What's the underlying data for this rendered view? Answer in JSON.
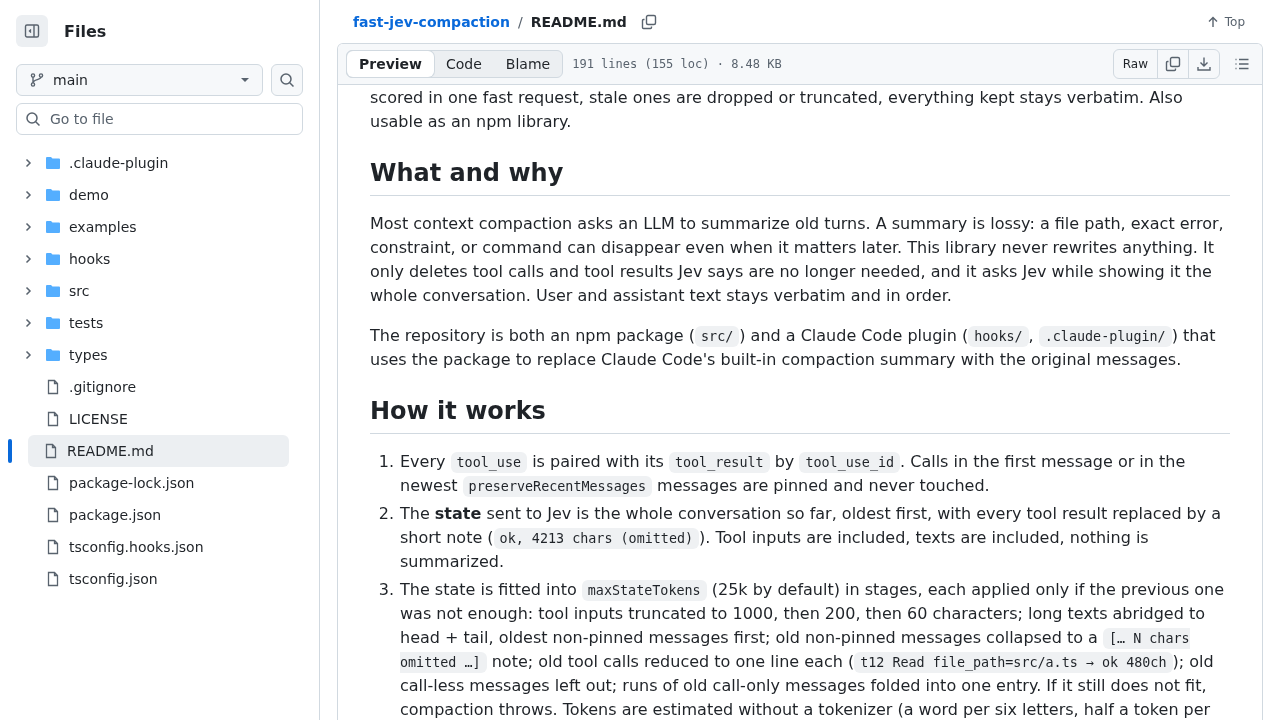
{
  "sidebar": {
    "title": "Files",
    "branch": "main",
    "search": {
      "placeholder": "Go to file"
    },
    "tree": [
      {
        "kind": "folder",
        "name": ".claude-plugin",
        "expanded": false,
        "selected": false
      },
      {
        "kind": "folder",
        "name": "demo",
        "expanded": false,
        "selected": false
      },
      {
        "kind": "folder",
        "name": "examples",
        "expanded": false,
        "selected": false
      },
      {
        "kind": "folder",
        "name": "hooks",
        "expanded": false,
        "selected": false
      },
      {
        "kind": "folder",
        "name": "src",
        "expanded": false,
        "selected": false
      },
      {
        "kind": "folder",
        "name": "tests",
        "expanded": false,
        "selected": false
      },
      {
        "kind": "folder",
        "name": "types",
        "expanded": false,
        "selected": false
      },
      {
        "kind": "file",
        "name": ".gitignore",
        "selected": false
      },
      {
        "kind": "file",
        "name": "LICENSE",
        "selected": false
      },
      {
        "kind": "file",
        "name": "README.md",
        "selected": true
      },
      {
        "kind": "file",
        "name": "package-lock.json",
        "selected": false
      },
      {
        "kind": "file",
        "name": "package.json",
        "selected": false
      },
      {
        "kind": "file",
        "name": "tsconfig.hooks.json",
        "selected": false
      },
      {
        "kind": "file",
        "name": "tsconfig.json",
        "selected": false
      }
    ]
  },
  "breadcrumb": {
    "repo": "fast-jev-compaction",
    "separator": "/",
    "file": "README.md"
  },
  "top_link": "Top",
  "view_tabs": [
    {
      "label": "Preview",
      "selected": true
    },
    {
      "label": "Code",
      "selected": false
    },
    {
      "label": "Blame",
      "selected": false
    }
  ],
  "file_info": "191 lines (155 loc) · 8.48 KB",
  "raw_button": "Raw",
  "readme": [
    {
      "kind": "paragraph",
      "segments": [
        {
          "kind": "text",
          "text": "scored in one fast request, stale ones are dropped or truncated, everything kept stays verbatim. Also usable as an npm library."
        }
      ]
    },
    {
      "kind": "heading",
      "text": "What and why"
    },
    {
      "kind": "paragraph",
      "segments": [
        {
          "kind": "text",
          "text": "Most context compaction asks an LLM to summarize old turns. A summary is lossy: a file path, exact error, constraint, or command can disappear even when it matters later. This library never rewrites anything. It only deletes tool calls and tool results Jev says are no longer needed, and it asks Jev while showing it the whole conversation. User and assistant text stays verbatim and in order."
        }
      ]
    },
    {
      "kind": "paragraph",
      "segments": [
        {
          "kind": "text",
          "text": "The repository is both an npm package ("
        },
        {
          "kind": "code",
          "text": "src/"
        },
        {
          "kind": "text",
          "text": ") and a Claude Code plugin ("
        },
        {
          "kind": "code",
          "text": "hooks/"
        },
        {
          "kind": "text",
          "text": ", "
        },
        {
          "kind": "code",
          "text": ".claude-plugin/"
        },
        {
          "kind": "text",
          "text": ") that uses the package to replace Claude Code's built-in compaction summary with the original messages."
        }
      ]
    },
    {
      "kind": "heading",
      "text": "How it works"
    },
    {
      "kind": "list",
      "items": [
        {
          "number": "1.",
          "segments": [
            {
              "kind": "text",
              "text": "Every "
            },
            {
              "kind": "code",
              "text": "tool_use"
            },
            {
              "kind": "text",
              "text": " is paired with its "
            },
            {
              "kind": "code",
              "text": "tool_result"
            },
            {
              "kind": "text",
              "text": " by "
            },
            {
              "kind": "code",
              "text": "tool_use_id"
            },
            {
              "kind": "text",
              "text": ". Calls in the first message or in the newest "
            },
            {
              "kind": "code",
              "text": "preserveRecentMessages"
            },
            {
              "kind": "text",
              "text": " messages are pinned and never touched."
            }
          ]
        },
        {
          "number": "2.",
          "segments": [
            {
              "kind": "text",
              "text": "The **state** sent to Jev is the whole conversation so far, oldest first, with every tool result replaced by a short note ("
            },
            {
              "kind": "code",
              "text": "ok, 4213 chars (omitted)"
            },
            {
              "kind": "text",
              "text": "). Tool inputs are included, texts are included, nothing is summarized."
            }
          ]
        },
        {
          "number": "3.",
          "segments": [
            {
              "kind": "text",
              "text": "The state is fitted into "
            },
            {
              "kind": "code",
              "text": "maxStateTokens"
            },
            {
              "kind": "text",
              "text": " (25k by default) in stages, each applied only if the previous one was not enough: tool inputs truncated to 1000, then 200, then 60 characters; long texts abridged to head + tail, oldest non-pinned messages first; old non-pinned messages collapsed to a "
            },
            {
              "kind": "code",
              "text": "[… N chars omitted …]"
            },
            {
              "kind": "text",
              "text": " note; old tool calls reduced to one line each ("
            },
            {
              "kind": "code",
              "text": "t12 Read file_path=src/a.ts → ok 480ch"
            },
            {
              "kind": "text",
              "text": "); old call-less messages left out; runs of old call-only messages folded into one entry. If it still does not fit, compaction throws. Tokens are estimated without a tokenizer (a word per six letters, half a token per"
            }
          ]
        }
      ]
    }
  ]
}
